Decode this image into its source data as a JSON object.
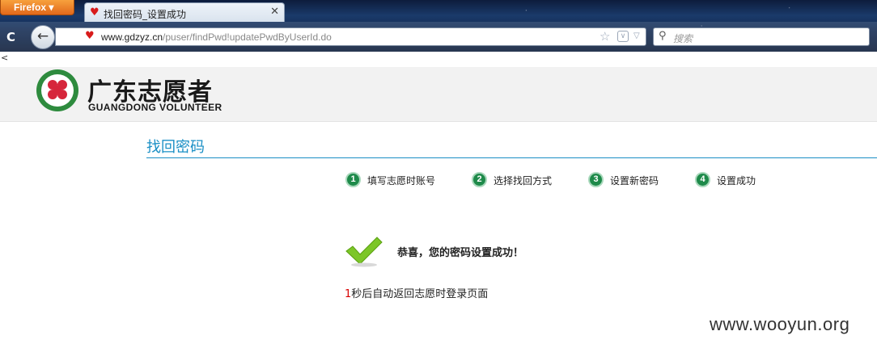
{
  "browser": {
    "app_button": "Firefox ▾",
    "tab_title": "找回密码_设置成功",
    "tab_close": "✕",
    "url_host": "www.gdzyz.cn",
    "url_path": "/puser/findPwd!updatePwdByUserId.do",
    "search_placeholder": "搜索"
  },
  "stray_text": "<",
  "header": {
    "logo_cn": "广东志愿者",
    "logo_en": "GUANGDONG VOLUNTEER"
  },
  "page": {
    "title": "找回密码",
    "steps": [
      {
        "num": "1",
        "label": "填写志愿时账号"
      },
      {
        "num": "2",
        "label": "选择找回方式"
      },
      {
        "num": "3",
        "label": "设置新密码"
      },
      {
        "num": "4",
        "label": "设置成功"
      }
    ],
    "success_message": "恭喜，您的密码设置成功！",
    "countdown_number": "1",
    "countdown_text": "秒后自动返回志愿时登录页面"
  },
  "watermark": "www.wooyun.org",
  "colors": {
    "accent": "#1a8fc5",
    "step_green": "#1e8a4a",
    "check_green": "#7cc628",
    "countdown_red": "#d80000"
  },
  "icons": [
    "reload-icon",
    "back-arrow-icon",
    "key-icon",
    "heart-favicon-icon",
    "bookmark-star-icon",
    "pocket-icon",
    "dropdown-icon",
    "search-icon",
    "checkmark-icon",
    "logo-emblem-icon"
  ]
}
